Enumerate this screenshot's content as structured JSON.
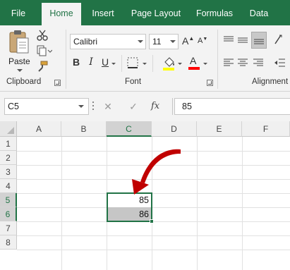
{
  "tabs": [
    "File",
    "Home",
    "Insert",
    "Page Layout",
    "Formulas",
    "Data"
  ],
  "active_tab": "Home",
  "clipboard": {
    "paste_label": "Paste",
    "group_label": "Clipboard"
  },
  "font": {
    "name": "Calibri",
    "size": "11",
    "group_label": "Font",
    "bold": "B",
    "italic": "I",
    "underline": "U",
    "grow": "A",
    "shrink": "A"
  },
  "alignment": {
    "group_label": "Alignment"
  },
  "formula_bar": {
    "name_box": "C5",
    "cancel_icon": "✕",
    "enter_icon": "✓",
    "fx": "fx",
    "value": "85"
  },
  "columns": [
    "A",
    "B",
    "C",
    "D",
    "E",
    "F"
  ],
  "selected_column": "C",
  "rows": [
    "1",
    "2",
    "3",
    "4",
    "5",
    "6",
    "7",
    "8"
  ],
  "selected_rows": [
    "5",
    "6"
  ],
  "cells": {
    "C5": "85",
    "C6": "86"
  },
  "colors": {
    "accent": "#217346",
    "arrow": "#c00000",
    "fill_highlight": "#ffff00",
    "font_color": "#ff0000"
  }
}
